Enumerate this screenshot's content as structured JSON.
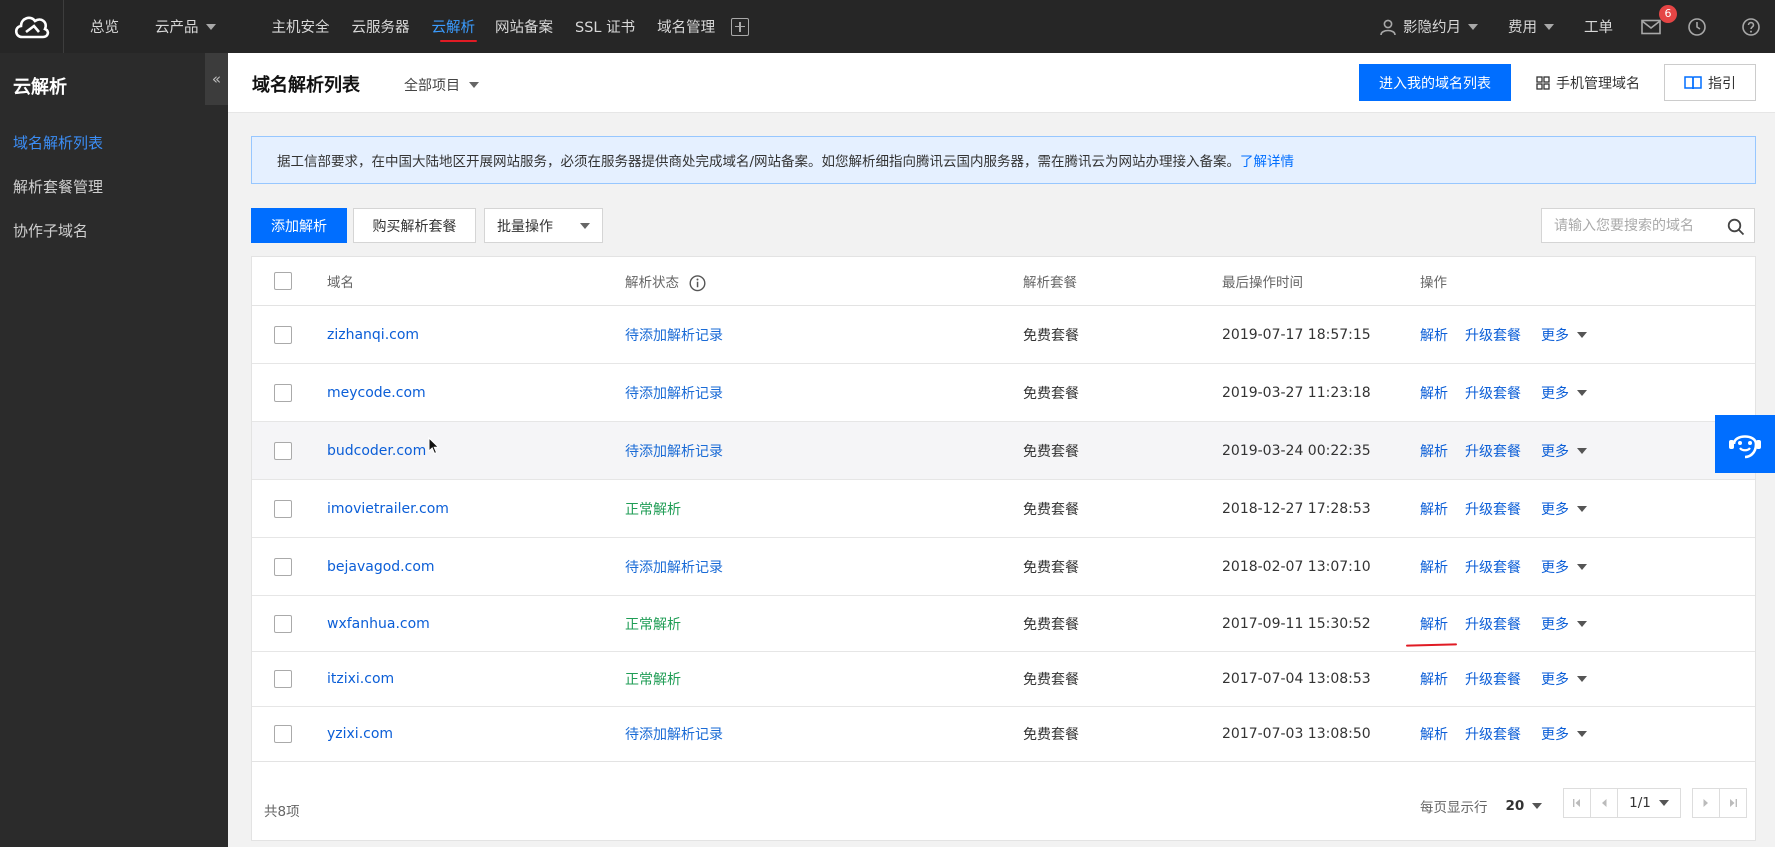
{
  "topnav": {
    "items": [
      {
        "label": "总览"
      },
      {
        "label": "云产品"
      },
      {
        "label": "主机安全"
      },
      {
        "label": "云服务器"
      },
      {
        "label": "云解析"
      },
      {
        "label": "网站备案"
      },
      {
        "label": "SSL 证书"
      },
      {
        "label": "域名管理"
      }
    ],
    "user": "影隐约月",
    "billing": "费用",
    "ticket": "工单",
    "mail_badge": "6"
  },
  "sidebar": {
    "title": "云解析",
    "items": [
      {
        "label": "域名解析列表"
      },
      {
        "label": "解析套餐管理"
      },
      {
        "label": "协作子域名"
      }
    ]
  },
  "header": {
    "title": "域名解析列表",
    "project": "全部项目",
    "enter_button": "进入我的域名列表",
    "mobile_link": "手机管理域名",
    "guide_button": "指引"
  },
  "notice": {
    "text": "据工信部要求，在中国大陆地区开展网站服务，必须在服务器提供商处完成域名/网站备案。如您解析细指向腾讯云国内服务器，需在腾讯云为网站办理接入备案。",
    "link": "了解详情"
  },
  "toolbar": {
    "add": "添加解析",
    "buy": "购买解析套餐",
    "batch": "批量操作",
    "search_placeholder": "请输入您要搜索的域名"
  },
  "table": {
    "headers": {
      "domain": "域名",
      "status": "解析状态",
      "plan": "解析套餐",
      "time": "最后操作时间",
      "ops": "操作"
    },
    "ops": {
      "resolve": "解析",
      "upgrade": "升级套餐",
      "more": "更多"
    },
    "rows": [
      {
        "domain": "zizhanqi.com",
        "status": "待添加解析记录",
        "plan": "免费套餐",
        "time": "2019-07-17 18:57:15"
      },
      {
        "domain": "meycode.com",
        "status": "待添加解析记录",
        "plan": "免费套餐",
        "time": "2019-03-27 11:23:18"
      },
      {
        "domain": "budcoder.com",
        "status": "待添加解析记录",
        "plan": "免费套餐",
        "time": "2019-03-24 00:22:35"
      },
      {
        "domain": "imovietrailer.com",
        "status": "正常解析",
        "plan": "免费套餐",
        "time": "2018-12-27 17:28:53"
      },
      {
        "domain": "bejavagod.com",
        "status": "待添加解析记录",
        "plan": "免费套餐",
        "time": "2018-02-07 13:07:10"
      },
      {
        "domain": "wxfanhua.com",
        "status": "正常解析",
        "plan": "免费套餐",
        "time": "2017-09-11 15:30:52"
      },
      {
        "domain": "itzixi.com",
        "status": "正常解析",
        "plan": "免费套餐",
        "time": "2017-07-04 13:08:53"
      },
      {
        "domain": "yzixi.com",
        "status": "待添加解析记录",
        "plan": "免费套餐",
        "time": "2017-07-03 13:08:50"
      }
    ],
    "total": "共8项",
    "per_page_label": "每页显示行",
    "per_page": "20",
    "page": "1/1"
  },
  "colors": {
    "primary": "#006eff",
    "nav_bg": "#262626",
    "sidebar_bg": "#2b2b2b",
    "ok": "#1f9d55",
    "annotation": "#e01b24"
  }
}
